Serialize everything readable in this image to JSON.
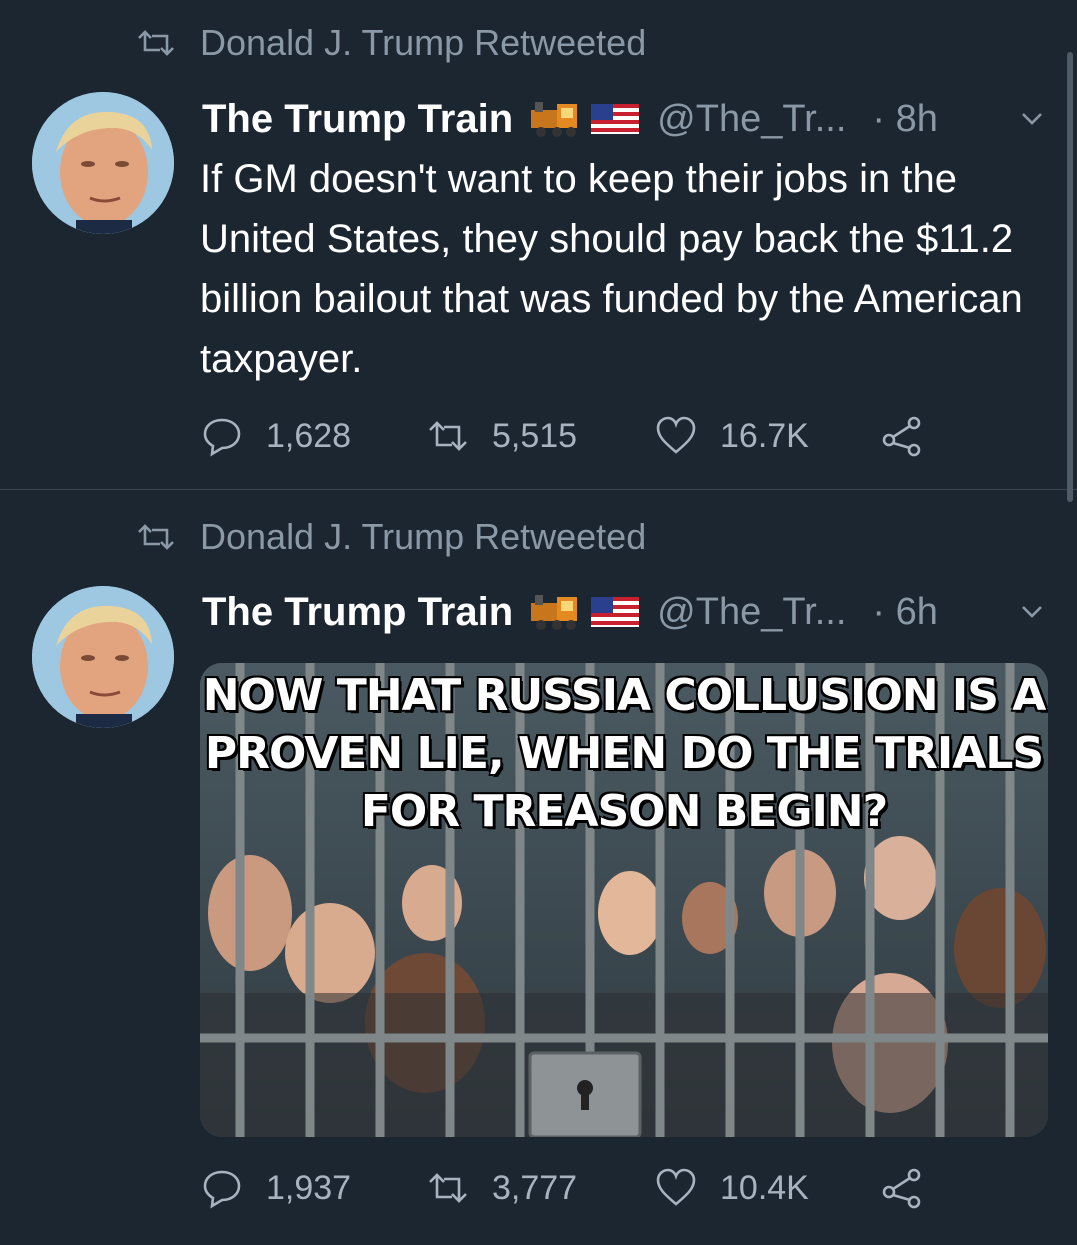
{
  "tweets": [
    {
      "retweeted_by": "Donald J. Trump Retweeted",
      "author_name": "The Trump Train",
      "handle": "@The_Tr...",
      "time": "· 8h",
      "text": "If GM doesn't want to keep their jobs in the United States, they should pay back the $11.2 billion bailout that was funded by the American taxpayer.",
      "replies": "1,628",
      "retweets": "5,515",
      "likes": "16.7K"
    },
    {
      "retweeted_by": "Donald J. Trump Retweeted",
      "author_name": "The Trump Train",
      "handle": "@The_Tr...",
      "time": "· 6h",
      "media_text": "NOW THAT RUSSIA COLLUSION IS A PROVEN LIE, WHEN DO THE TRIALS FOR TREASON BEGIN?",
      "replies": "1,937",
      "retweets": "3,777",
      "likes": "10.4K"
    }
  ],
  "icons": {
    "retweeted": "retweet-icon",
    "badge_train": "train-emoji-icon",
    "badge_flag": "us-flag-emoji-icon",
    "caret": "chevron-down-icon",
    "reply": "reply-bubble-icon",
    "retweet": "retweet-icon",
    "like": "heart-icon",
    "share": "share-icon"
  },
  "colors": {
    "background": "#1b2631",
    "secondary_text": "#8b98a5",
    "divider": "#3a4652"
  }
}
